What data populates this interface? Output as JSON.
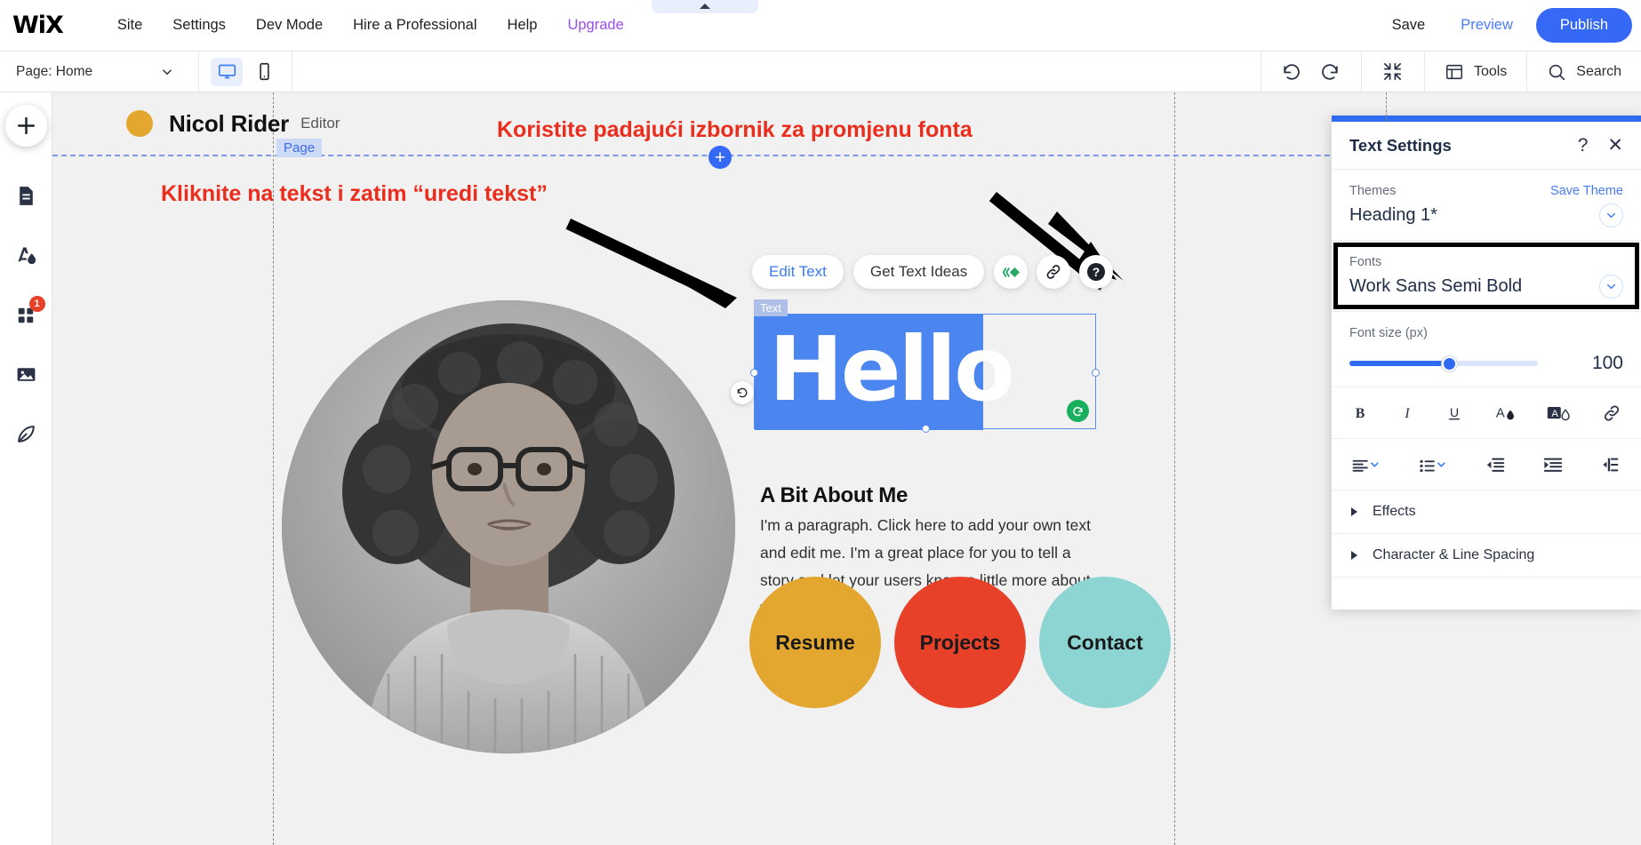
{
  "topbar": {
    "logo": "WiX",
    "nav": [
      {
        "label": "Site",
        "accent": false
      },
      {
        "label": "Settings",
        "accent": false
      },
      {
        "label": "Dev Mode",
        "accent": false
      },
      {
        "label": "Hire a Professional",
        "accent": false
      },
      {
        "label": "Help",
        "accent": false
      },
      {
        "label": "Upgrade",
        "accent": true
      }
    ],
    "save_label": "Save",
    "preview_label": "Preview",
    "publish_label": "Publish"
  },
  "secondbar": {
    "page_label": "Page: Home",
    "desktop_icon": "desktop-icon",
    "mobile_icon": "mobile-icon",
    "undo_icon": "undo-icon",
    "redo_icon": "redo-icon",
    "zoomout_icon": "zoom-out-icon",
    "tools_label": "Tools",
    "search_label": "Search"
  },
  "sidebar": {
    "add_icon": "plus-icon",
    "items": [
      {
        "icon": "pages-icon",
        "badge": ""
      },
      {
        "icon": "theme-paint-icon",
        "badge": ""
      },
      {
        "icon": "apps-grid-icon",
        "badge": "1"
      },
      {
        "icon": "media-image-icon",
        "badge": ""
      },
      {
        "icon": "blog-pen-icon",
        "badge": ""
      }
    ]
  },
  "canvas": {
    "site_name": "Nicol Rider",
    "site_role": "Editor",
    "page_tag": "Page",
    "add_section_icon": "plus-icon",
    "annotations": [
      {
        "text": "Koristite padajući izbornik za promjenu fonta"
      },
      {
        "text": "Kliknite na tekst i zatim “uredi tekst”"
      }
    ],
    "text_toolbar": {
      "edit_text": "Edit Text",
      "get_text_ideas": "Get Text Ideas",
      "animation_icon": "animation-icon",
      "link_icon": "link-icon",
      "help_icon": "help-icon",
      "rotate_icon": "rotate-icon"
    },
    "selection_tag": "Text",
    "hello_text": "Hello",
    "about_heading": "A Bit About Me",
    "about_paragraph": "I'm a paragraph. Click here to add your own text and edit me. I'm a great place for you to tell a story and let your users know a little more about you.",
    "circle_buttons": [
      {
        "label": "Resume",
        "color": "#e3a72f"
      },
      {
        "label": "Projects",
        "color": "#e8412a"
      },
      {
        "label": "Contact",
        "color": "#8cd5d3"
      }
    ]
  },
  "panel": {
    "title": "Text Settings",
    "help_icon": "question-mark-icon",
    "close_icon": "close-icon",
    "themes_label": "Themes",
    "save_theme_label": "Save Theme",
    "theme_value": "Heading 1*",
    "fonts_label": "Fonts",
    "font_value": "Work Sans Semi Bold",
    "font_size_label": "Font size (px)",
    "font_size_value": "100",
    "format_icons": [
      {
        "name": "bold-icon",
        "glyph": "B"
      },
      {
        "name": "italic-icon",
        "glyph": "I"
      },
      {
        "name": "underline-icon",
        "glyph": "U"
      },
      {
        "name": "text-color-icon",
        "glyph": "A"
      },
      {
        "name": "highlight-color-icon",
        "glyph": "A"
      },
      {
        "name": "link-icon",
        "glyph": "link"
      }
    ],
    "paragraph_icons": [
      {
        "name": "text-align-icon"
      },
      {
        "name": "bullet-list-icon"
      },
      {
        "name": "outdent-icon"
      },
      {
        "name": "indent-icon"
      },
      {
        "name": "text-direction-icon"
      }
    ],
    "effects_label": "Effects",
    "spacing_label": "Character & Line Spacing"
  },
  "colors": {
    "brand_blue": "#3568f4",
    "accent_purple": "#9b4df0",
    "annotation_red": "#ea2d1c",
    "selection_blue": "#4a85f0",
    "panel_blue": "#2f6bf0"
  }
}
